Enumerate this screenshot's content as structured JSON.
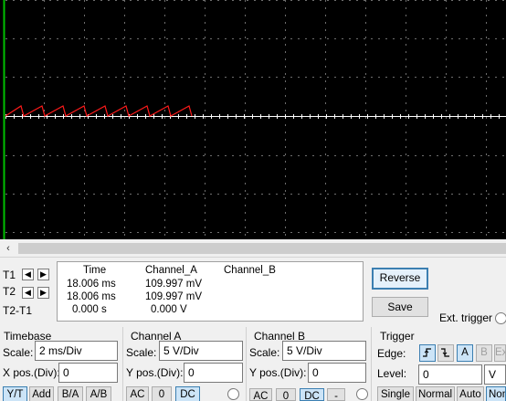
{
  "colors": {
    "grid": "#6e6e6e",
    "trace_a": "#ff1a1a",
    "baseline": "#ffffff",
    "left_edge": "#00c000",
    "background": "#000000"
  },
  "scrollbar": {
    "left_arrow": "‹"
  },
  "cursors": {
    "t1_label": "T1",
    "t2_label": "T2",
    "t2t1_label": "T2-T1",
    "left_arrow": "◀",
    "right_arrow": "▶"
  },
  "readout": {
    "headers": [
      "Time",
      "Channel_A",
      "Channel_B"
    ],
    "rows": [
      [
        "18.006 ms",
        "109.997 mV",
        ""
      ],
      [
        "18.006 ms",
        "109.997 mV",
        ""
      ],
      [
        "0.000 s",
        "0.000 V",
        ""
      ]
    ]
  },
  "buttons": {
    "reverse": "Reverse",
    "save": "Save"
  },
  "ext_trigger_label": "Ext. trigger",
  "timebase": {
    "title": "Timebase",
    "scale_label": "Scale:",
    "scale_value": "2 ms/Div",
    "xpos_label": "X pos.(Div):",
    "xpos_value": "0",
    "modes": [
      "Y/T",
      "Add",
      "B/A",
      "A/B"
    ]
  },
  "channel_a": {
    "title": "Channel A",
    "scale_label": "Scale:",
    "scale_value": "5  V/Div",
    "ypos_label": "Y pos.(Div):",
    "ypos_value": "0",
    "coupling": [
      "AC",
      "0",
      "DC"
    ]
  },
  "channel_b": {
    "title": "Channel B",
    "scale_label": "Scale:",
    "scale_value": "5  V/Div",
    "ypos_label": "Y pos.(Div):",
    "ypos_value": "0",
    "coupling": [
      "AC",
      "0",
      "DC",
      "-"
    ]
  },
  "trigger": {
    "title": "Trigger",
    "edge_label": "Edge:",
    "edge_buttons": [
      "F",
      "R",
      "A",
      "B",
      "Ext"
    ],
    "level_label": "Level:",
    "level_value": "0",
    "level_unit": "V",
    "modes": [
      "Single",
      "Normal",
      "Auto",
      "None"
    ]
  }
}
